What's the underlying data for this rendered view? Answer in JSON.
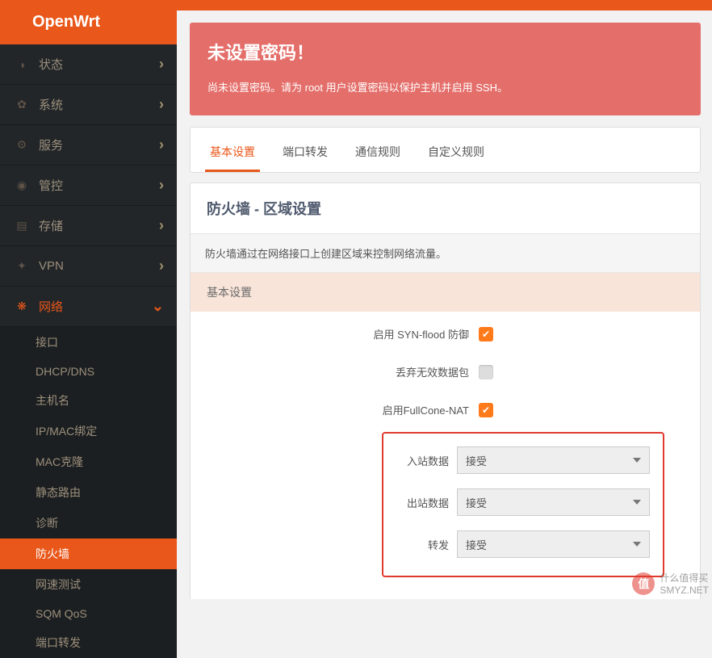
{
  "brand": "OpenWrt",
  "nav": [
    {
      "label": "状态",
      "icon": "status-icon"
    },
    {
      "label": "系统",
      "icon": "system-icon"
    },
    {
      "label": "服务",
      "icon": "services-icon"
    },
    {
      "label": "管控",
      "icon": "control-icon"
    },
    {
      "label": "存储",
      "icon": "storage-icon"
    },
    {
      "label": "VPN",
      "icon": "vpn-icon"
    },
    {
      "label": "网络",
      "icon": "network-icon",
      "expanded": true
    }
  ],
  "subnav": [
    "接口",
    "DHCP/DNS",
    "主机名",
    "IP/MAC绑定",
    "MAC克隆",
    "静态路由",
    "诊断",
    "防火墙",
    "网速测试",
    "SQM QoS",
    "端口转发"
  ],
  "subnav_active": "防火墙",
  "alert": {
    "title": "未设置密码！",
    "text": "尚未设置密码。请为 root 用户设置密码以保护主机并启用 SSH。"
  },
  "tabs": [
    "基本设置",
    "端口转发",
    "通信规则",
    "自定义规则"
  ],
  "tabs_active": "基本设置",
  "section": {
    "title": "防火墙 - 区域设置",
    "desc": "防火墙通过在网络接口上创建区域来控制网络流量。",
    "group": "基本设置"
  },
  "fields": {
    "synflood_label": "启用 SYN-flood 防御",
    "synflood_checked": true,
    "dropinvalid_label": "丢弃无效数据包",
    "dropinvalid_checked": false,
    "fullcone_label": "启用FullCone-NAT",
    "fullcone_checked": true,
    "input_label": "入站数据",
    "input_value": "接受",
    "output_label": "出站数据",
    "output_value": "接受",
    "forward_label": "转发",
    "forward_value": "接受"
  },
  "watermark": {
    "brand": "值",
    "text1": "什么值得买",
    "text2": "SMYZ.NET"
  }
}
